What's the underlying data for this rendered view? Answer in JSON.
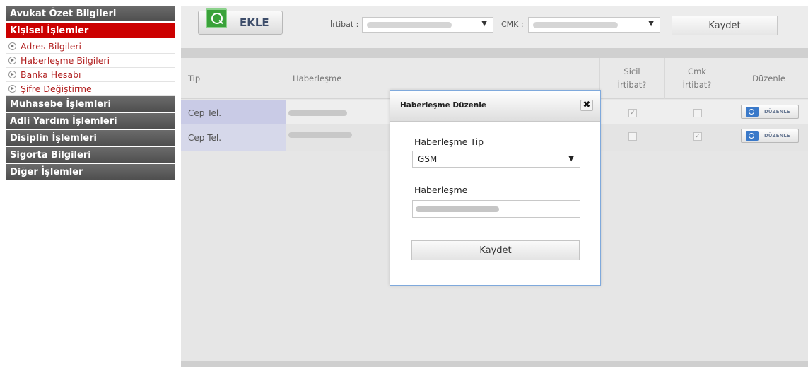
{
  "sidebar": {
    "sections": [
      {
        "label": "Avukat Özet Bilgileri",
        "active": false
      },
      {
        "label": "Kişisel İşlemler",
        "active": true
      }
    ],
    "sub_items": [
      {
        "label": "Adres Bilgileri",
        "icon": "arrow-circle-icon"
      },
      {
        "label": "Haberleşme Bilgileri",
        "icon": "arrow-circle-icon"
      },
      {
        "label": "Banka Hesabı",
        "icon": "arrow-circle-icon"
      },
      {
        "label": "Şifre Değiştirme",
        "icon": "arrow-circle-icon"
      }
    ],
    "more_sections": [
      {
        "label": "Muhasebe İşlemleri"
      },
      {
        "label": "Adli Yardım İşlemleri"
      },
      {
        "label": "Disiplin İşlemleri"
      },
      {
        "label": "Sigorta Bilgileri"
      },
      {
        "label": "Diğer İşlemler"
      }
    ],
    "active_color": "#cc0000",
    "section_color": "#5a5a5a"
  },
  "toolbar": {
    "add_label": "EKLE",
    "add_icon": "zoom-in-icon",
    "contact_label": "İrtibat :",
    "cmk_label": "CMK :",
    "save_label": "Kaydet"
  },
  "table": {
    "headers": {
      "type": "Tip",
      "comm": "Haberleşme",
      "sicil_line1": "Sicil",
      "sicil_line2": "İrtibat?",
      "cmk_line1": "Cmk",
      "cmk_line2": "İrtibat?",
      "edit": "Düzenle"
    },
    "rows": [
      {
        "type": "Cep Tel.",
        "sicil_checked": true,
        "cmk_checked": false,
        "edit_label": "DÜZENLE"
      },
      {
        "type": "Cep Tel.",
        "sicil_checked": false,
        "cmk_checked": true,
        "edit_label": "DÜZENLE"
      }
    ]
  },
  "modal": {
    "title": "Haberleşme Düzenle",
    "type_label": "Haberleşme Tip",
    "type_value": "GSM",
    "comm_label": "Haberleşme",
    "save_label": "Kaydet",
    "close_glyph": "✖"
  }
}
